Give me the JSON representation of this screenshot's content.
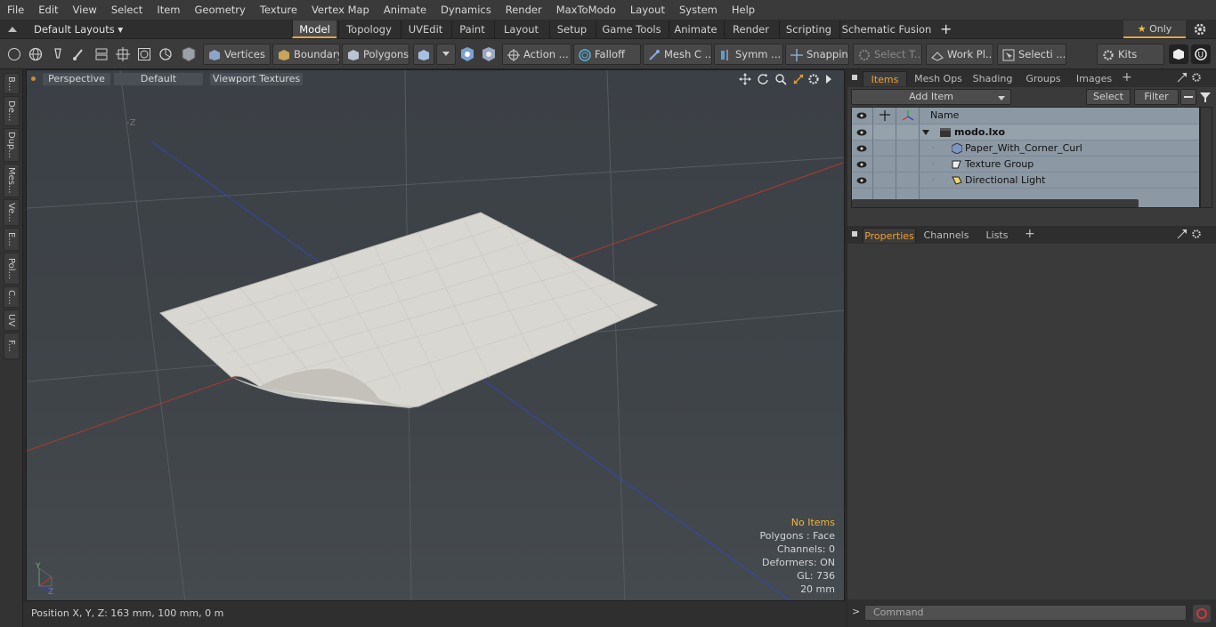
{
  "menu": [
    "File",
    "Edit",
    "View",
    "Select",
    "Item",
    "Geometry",
    "Texture",
    "Vertex Map",
    "Animate",
    "Dynamics",
    "Render",
    "MaxToModo",
    "Layout",
    "System",
    "Help"
  ],
  "layout_selector": "Default Layouts ▾",
  "tabs": [
    "Model",
    "Topology",
    "UVEdit",
    "Paint",
    "Layout",
    "Setup",
    "Game Tools",
    "Animate",
    "Render",
    "Scripting",
    "Schematic Fusion"
  ],
  "active_tab": "Model",
  "only_label": "Only",
  "toolbar": {
    "vertices": "Vertices",
    "boundary": "Boundary",
    "polygons": "Polygons",
    "action": "Action ...",
    "falloff": "Falloff",
    "mesh": "Mesh C ...",
    "symm": "Symm ...",
    "snapping": "Snapping",
    "select_t": "Select T...",
    "work_pl": "Work Pl...",
    "selecti": "Selecti ...",
    "kits": "Kits"
  },
  "left_tabs": [
    "B...",
    "De...",
    "Dup...",
    "Mes...",
    "Ve...",
    "E...",
    "Pol...",
    "C...",
    "UV",
    "F..."
  ],
  "viewport": {
    "view": "Perspective",
    "shading": "Default",
    "textures": "Viewport Textures",
    "overlay": {
      "no_items": "No Items",
      "polygons": "Polygons : Face",
      "channels": "Channels: 0",
      "deformers": "Deformers: ON",
      "gl": "GL: 736",
      "scale": "20 mm"
    }
  },
  "status": "Position X, Y, Z:   163 mm, 100 mm, 0 m",
  "items_panel": {
    "tabs": [
      "Items",
      "Mesh Ops",
      "Shading",
      "Groups",
      "Images"
    ],
    "add_item": "Add Item",
    "select": "Select",
    "filter": "Filter",
    "name_header": "Name",
    "rows": [
      "modo.lxo",
      "Paper_With_Corner_Curl",
      "Texture Group",
      "Directional Light"
    ]
  },
  "properties_panel": {
    "tabs": [
      "Properties",
      "Channels",
      "Lists"
    ]
  },
  "command_placeholder": "Command",
  "colors": {
    "accent": "#f0a030",
    "x_axis": "#c0392b",
    "z_axis": "#3b4fc4",
    "list_bg": "#8c99a4"
  }
}
